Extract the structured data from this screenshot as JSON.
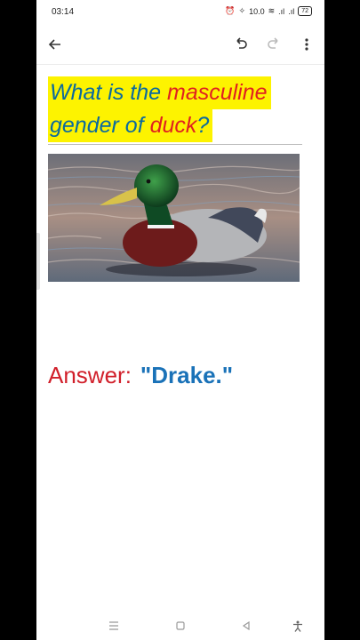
{
  "status_bar": {
    "time": "03:14",
    "speed": "10.0",
    "battery": "72"
  },
  "toolbar": {
    "back_icon": "arrow-left-icon",
    "undo_icon": "undo-icon",
    "redo_icon": "redo-icon",
    "more_icon": "more-vertical-icon"
  },
  "question": {
    "line1_part1": "What is the ",
    "line1_part2": "masculine",
    "line2_part1": "gender of ",
    "line2_part2": "duck",
    "line2_part3": "?",
    "highlight_color": "#fdf300",
    "blue_color": "#0b6a9e",
    "red_color": "#e02020"
  },
  "image": {
    "subject": "mallard-drake-photo"
  },
  "answer": {
    "label": "Answer:",
    "value": "\"Drake.\""
  },
  "nav_bar": {
    "menu_icon": "menu-icon",
    "home_icon": "home-square-icon",
    "back_icon": "back-triangle-icon",
    "accessibility_icon": "accessibility-icon"
  }
}
